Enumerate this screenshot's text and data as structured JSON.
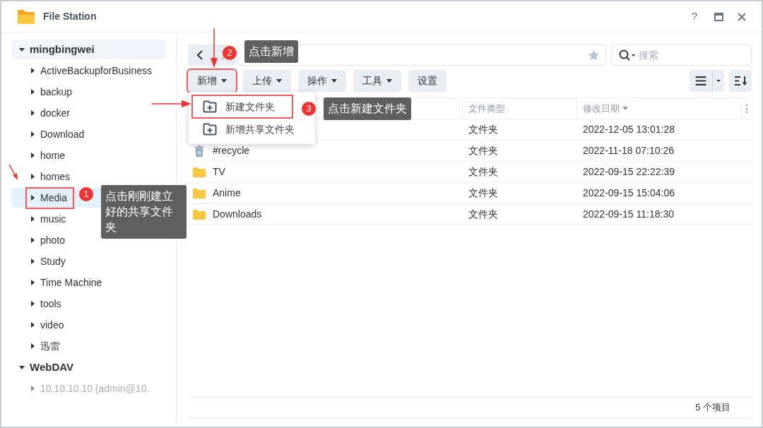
{
  "window": {
    "title": "File Station",
    "help_button": "?"
  },
  "sidebar": {
    "groups": [
      {
        "label": "mingbingwei",
        "expanded": true,
        "children": [
          {
            "label": "ActiveBackupforBusiness",
            "selected": false,
            "highlighted": false,
            "disabled": false
          },
          {
            "label": "backup",
            "selected": false,
            "highlighted": false,
            "disabled": false
          },
          {
            "label": "docker",
            "selected": false,
            "highlighted": false,
            "disabled": false
          },
          {
            "label": "Download",
            "selected": false,
            "highlighted": false,
            "disabled": false
          },
          {
            "label": "home",
            "selected": false,
            "highlighted": false,
            "disabled": false
          },
          {
            "label": "homes",
            "selected": false,
            "highlighted": false,
            "disabled": false
          },
          {
            "label": "Media",
            "selected": true,
            "highlighted": true,
            "disabled": false
          },
          {
            "label": "music",
            "selected": false,
            "highlighted": false,
            "disabled": false
          },
          {
            "label": "photo",
            "selected": false,
            "highlighted": false,
            "disabled": false
          },
          {
            "label": "Study",
            "selected": false,
            "highlighted": false,
            "disabled": false
          },
          {
            "label": "Time Machine",
            "selected": false,
            "highlighted": false,
            "disabled": false
          },
          {
            "label": "tools",
            "selected": false,
            "highlighted": false,
            "disabled": false
          },
          {
            "label": "video",
            "selected": false,
            "highlighted": false,
            "disabled": false
          },
          {
            "label": "迅雷",
            "selected": false,
            "highlighted": false,
            "disabled": false
          }
        ]
      },
      {
        "label": "WebDAV",
        "expanded": true,
        "children": [
          {
            "label": "10.10.10.10 (admin@10.",
            "selected": false,
            "highlighted": false,
            "disabled": true
          }
        ]
      }
    ]
  },
  "search": {
    "placeholder": "搜索"
  },
  "toolbar": [
    {
      "label": "新增",
      "has_menu": true,
      "highlighted": true
    },
    {
      "label": "上传",
      "has_menu": true,
      "highlighted": false
    },
    {
      "label": "操作",
      "has_menu": true,
      "highlighted": false
    },
    {
      "label": "工具",
      "has_menu": true,
      "highlighted": false
    },
    {
      "label": "设置",
      "has_menu": false,
      "highlighted": false
    }
  ],
  "dropdown_menu": [
    {
      "label": "新建文件夹",
      "highlighted": true
    },
    {
      "label": "新增共享文件夹",
      "highlighted": false
    }
  ],
  "table": {
    "columns": [
      "文件类型",
      "修改日期"
    ],
    "rows": [
      {
        "kind": "folder",
        "type": "文件夹",
        "modified": "2022-12-05 13:01:28"
      },
      {
        "kind": "recycle",
        "name": "#recycle",
        "type": "文件夹",
        "modified": "2022-11-18 07:10:26"
      },
      {
        "kind": "folder",
        "name": "TV",
        "type": "文件夹",
        "modified": "2022-09-15 22:22:39"
      },
      {
        "kind": "folder",
        "name": "Anime",
        "type": "文件夹",
        "modified": "2022-09-15 15:04:06"
      },
      {
        "kind": "folder",
        "name": "Downloads",
        "type": "文件夹",
        "modified": "2022-09-15 11:18:30"
      }
    ]
  },
  "status_bar": {
    "item_count": "5 个项目"
  },
  "annotations": [
    {
      "number": "1",
      "text": "点击刚刚建立好的共享文件夹"
    },
    {
      "number": "2",
      "text": "点击新增"
    },
    {
      "number": "3",
      "text": "点击新建文件夹"
    }
  ]
}
